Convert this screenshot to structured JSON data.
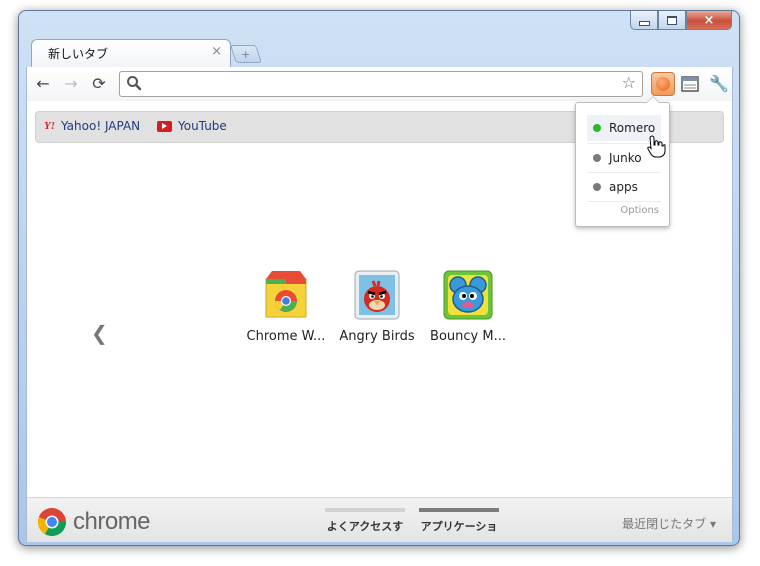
{
  "window": {
    "tab": {
      "title": "新しいタブ",
      "close_glyph": "×"
    },
    "newtab_glyph": "+",
    "controls": {
      "close_glyph": "×"
    }
  },
  "toolbar": {
    "back_glyph": "←",
    "forward_glyph": "→",
    "reload_glyph": "⟳",
    "star_glyph": "☆",
    "wrench_glyph": "🔧",
    "address_value": "",
    "address_placeholder": ""
  },
  "bookmarks": [
    {
      "label": "Yahoo! JAPAN",
      "icon": "yahoo-icon",
      "icon_text": "Y!"
    },
    {
      "label": "YouTube",
      "icon": "youtube-icon"
    }
  ],
  "apps": {
    "prev_glyph": "❮",
    "items": [
      {
        "label": "Chrome W...",
        "icon": "chrome-web-store-icon"
      },
      {
        "label": "Angry Birds",
        "icon": "angry-birds-icon"
      },
      {
        "label": "Bouncy M...",
        "icon": "bouncy-mouse-icon"
      }
    ]
  },
  "footer": {
    "brand": "chrome",
    "tabs": [
      {
        "label": "よくアクセスす",
        "active": false
      },
      {
        "label": "アプリケーショ",
        "active": true
      }
    ],
    "recent_label": "最近閉じたタブ ▾"
  },
  "popup": {
    "items": [
      {
        "label": "Romero",
        "status_color": "#2fb62f",
        "highlighted": true
      },
      {
        "label": "Junko",
        "status_color": "#7a7a7a",
        "highlighted": false
      },
      {
        "label": "apps",
        "status_color": "#7a7a7a",
        "highlighted": false
      }
    ],
    "options_label": "Options"
  },
  "colors": {
    "accent": "#f19a57",
    "link": "#1f3b7c"
  }
}
